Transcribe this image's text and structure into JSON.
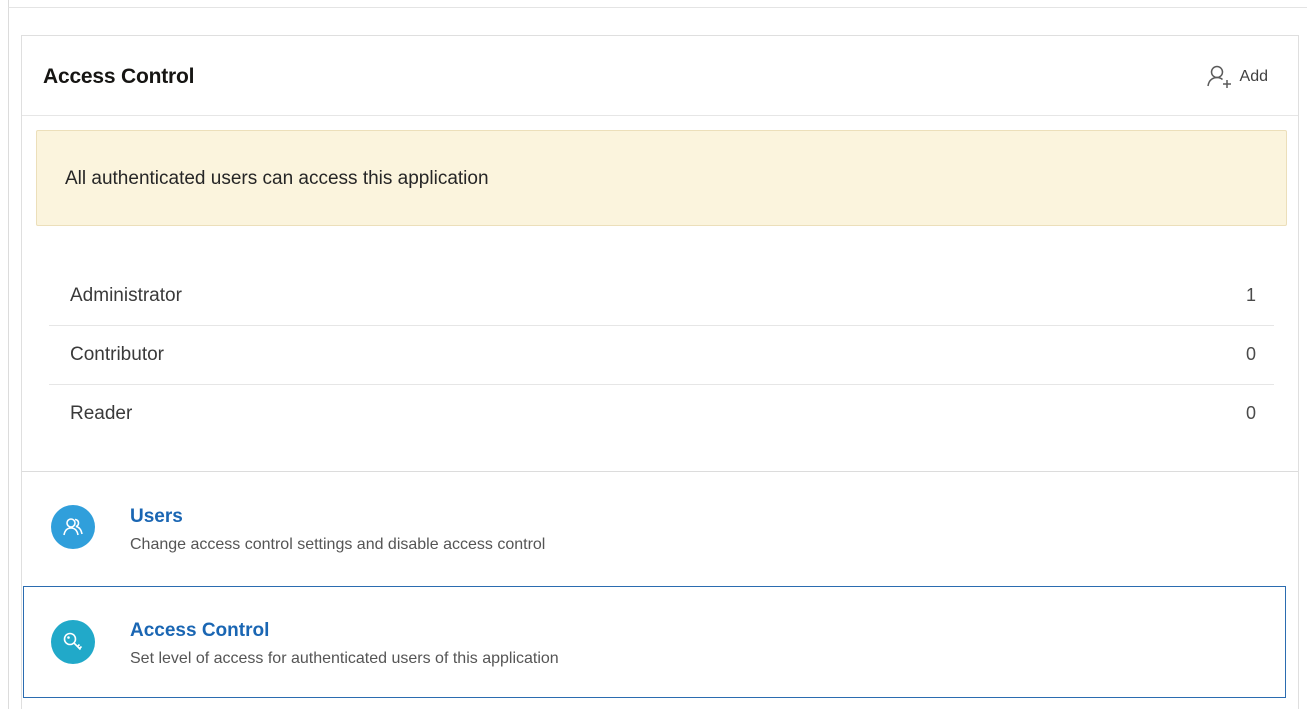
{
  "region": {
    "title": "Access Control",
    "add_label": "Add",
    "add_icon": "user-add-icon"
  },
  "alert": {
    "message": "All authenticated users can access this application",
    "background": "#fbf4dd"
  },
  "roles": [
    {
      "name": "Administrator",
      "count": "1"
    },
    {
      "name": "Contributor",
      "count": "0"
    },
    {
      "name": "Reader",
      "count": "0"
    }
  ],
  "links": {
    "users": {
      "title": "Users",
      "description": "Change access control settings and disable access control",
      "icon": "users-icon",
      "icon_color": "#309fdb"
    },
    "access_control": {
      "title": "Access Control",
      "description": "Set level of access for authenticated users of this application",
      "icon": "key-icon",
      "icon_color": "#21a9c9"
    }
  },
  "colors": {
    "link": "#1a66b3",
    "focus_border": "#2b6cb0"
  }
}
